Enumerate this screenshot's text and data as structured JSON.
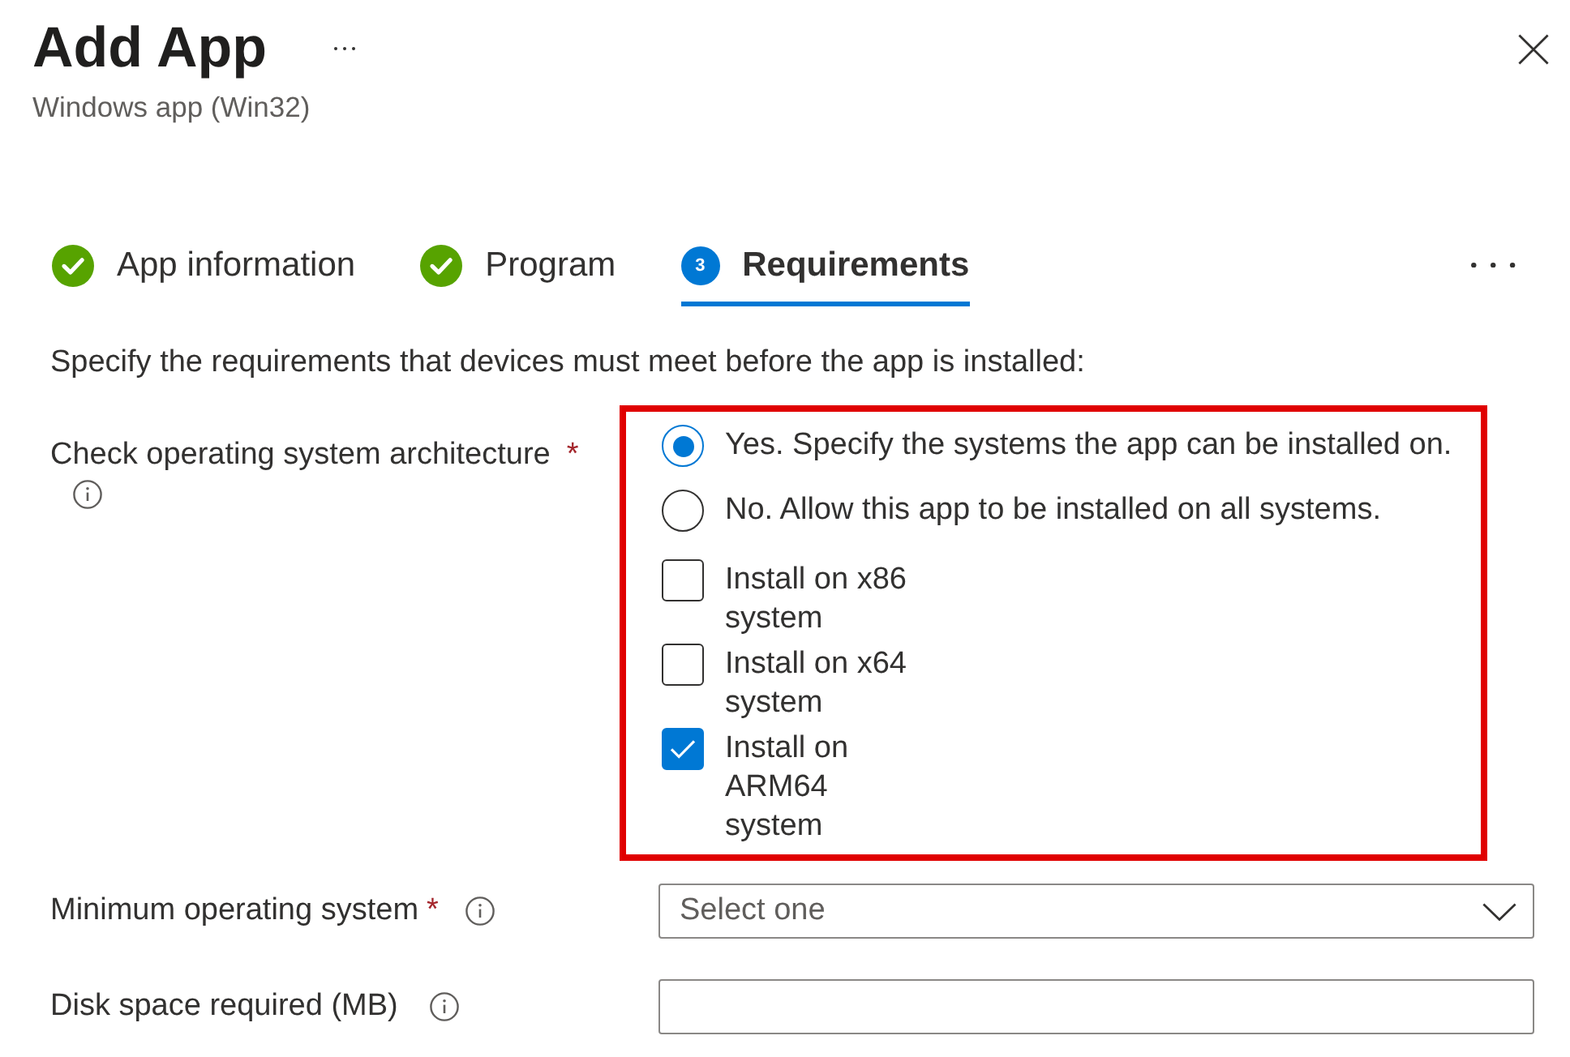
{
  "header": {
    "title": "Add App",
    "subtitle": "Windows app (Win32)"
  },
  "tabs": [
    {
      "label": "App information",
      "kind": "done",
      "selected": false
    },
    {
      "label": "Program",
      "kind": "done",
      "selected": false
    },
    {
      "label": "Requirements",
      "kind": "step",
      "number": "3",
      "selected": true
    }
  ],
  "description": "Specify the requirements that devices must meet before the app is installed:",
  "architecture": {
    "label": "Check operating system architecture",
    "required_mark": "*",
    "options": [
      {
        "label": "Yes. Specify the systems the app can be installed on.",
        "selected": true
      },
      {
        "label": "No. Allow this app to be installed on all systems.",
        "selected": false
      }
    ],
    "systems": [
      {
        "label": "Install on x86 system",
        "checked": false
      },
      {
        "label": "Install on x64 system",
        "checked": false
      },
      {
        "label": "Install on ARM64 system",
        "checked": true
      }
    ]
  },
  "fields": [
    {
      "kind": "dropdown",
      "label": "Minimum operating system",
      "required_mark": "*",
      "placeholder": "Select one"
    },
    {
      "kind": "text",
      "label": "Disk space required (MB)"
    }
  ]
}
